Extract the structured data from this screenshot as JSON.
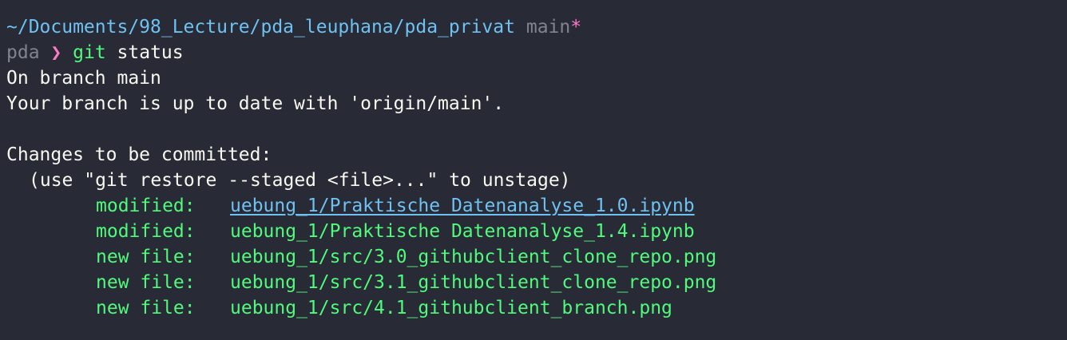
{
  "prompt": {
    "path": "~/Documents/98_Lecture/pda_leuphana/pda_privat",
    "branch": "main",
    "dirty_marker": "*",
    "env": "pda",
    "symbol": "❯",
    "command_name": "git",
    "command_args": "status"
  },
  "output": {
    "branch_line": "On branch main",
    "uptodate_line": "Your branch is up to date with 'origin/main'.",
    "changes_header": "Changes to be committed:",
    "hint": "(use \"git restore --staged <file>...\" to unstage)",
    "entries": [
      {
        "status": "modified:",
        "file": "uebung_1/Praktische Datenanalyse_1.0.ipynb"
      },
      {
        "status": "modified:",
        "file": "uebung_1/Praktische Datenanalyse_1.4.ipynb"
      },
      {
        "status": "new file:",
        "file": "uebung_1/src/3.0_githubclient_clone_repo.png"
      },
      {
        "status": "new file:",
        "file": "uebung_1/src/3.1_githubclient_clone_repo.png"
      },
      {
        "status": "new file:",
        "file": "uebung_1/src/4.1_githubclient_branch.png"
      }
    ]
  },
  "colors": {
    "background": "#282a36",
    "path": "#6ec1f1",
    "prompt_symbol": "#ff79c6",
    "command": "#50fa7b",
    "staged": "#50fa7b",
    "muted": "#7f8590"
  }
}
